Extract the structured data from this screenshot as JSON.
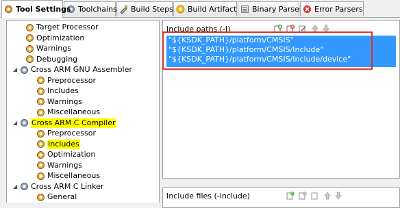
{
  "tabs": [
    {
      "label": "Tool Settings",
      "icon": "tool-settings-icon",
      "active": true
    },
    {
      "label": "Toolchains",
      "icon": "toolchains-icon"
    },
    {
      "label": "Build Steps",
      "icon": "build-steps-icon"
    },
    {
      "label": "Build Artifact",
      "icon": "build-artifact-icon"
    },
    {
      "label": "Binary Parsers",
      "icon": "binary-parsers-icon"
    },
    {
      "label": "Error Parsers",
      "icon": "error-parsers-icon"
    }
  ],
  "tree": [
    {
      "label": "Target Processor"
    },
    {
      "label": "Optimization"
    },
    {
      "label": "Warnings"
    },
    {
      "label": "Debugging"
    },
    {
      "label": "Cross ARM GNU Assembler",
      "expanded": true
    },
    {
      "label": "Preprocessor"
    },
    {
      "label": "Includes"
    },
    {
      "label": "Warnings"
    },
    {
      "label": "Miscellaneous"
    },
    {
      "label": "Cross ARM C Compiler",
      "expanded": true,
      "highlighted": true
    },
    {
      "label": "Preprocessor"
    },
    {
      "label": "Includes",
      "highlighted": true,
      "selected": true
    },
    {
      "label": "Optimization"
    },
    {
      "label": "Warnings"
    },
    {
      "label": "Miscellaneous"
    },
    {
      "label": "Cross ARM C Linker",
      "expanded": true
    },
    {
      "label": "General"
    }
  ],
  "include_paths": {
    "header": "Include paths (-I)",
    "items": [
      "\"${KSDK_PATH}/platform/CMSIS\"",
      "\"${KSDK_PATH}/platform/CMSIS/Include\"",
      "\"${KSDK_PATH}/platform/CMSIS/Include/device\""
    ]
  },
  "include_files": {
    "header": "Include files (-include)"
  },
  "colors": {
    "selection": "#3399ff",
    "highlight": "#ffff00",
    "annotation_box": "#e03030"
  }
}
